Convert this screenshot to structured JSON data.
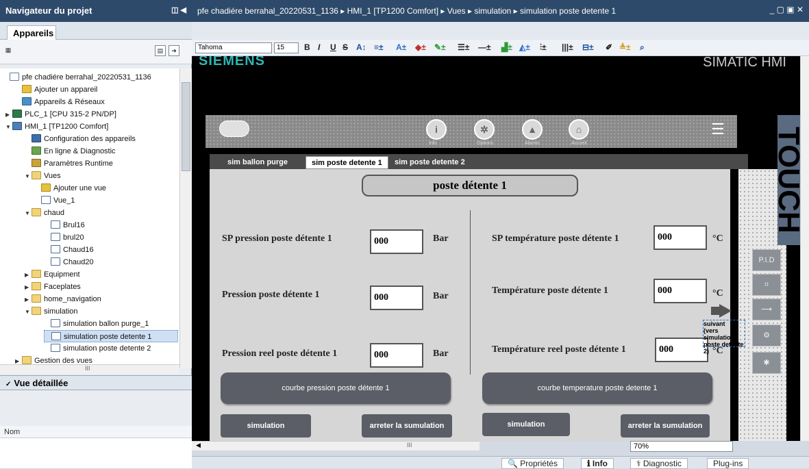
{
  "left_panel": {
    "title": "Navigateur du projet",
    "tab": "Appareils",
    "tree": [
      {
        "label": "pfe chadiére berrahal_20220531_1136",
        "icon": "project-icon"
      },
      {
        "label": "Ajouter un appareil",
        "icon": "add-device-icon"
      },
      {
        "label": "Appareils & Réseaux",
        "icon": "network-icon"
      },
      {
        "label": "PLC_1 [CPU 315-2 PN/DP]",
        "icon": "plc-icon"
      },
      {
        "label": "HMI_1 [TP1200 Comfort]",
        "icon": "hmi-icon"
      },
      {
        "label": "Configuration des appareils",
        "icon": "config-icon"
      },
      {
        "label": "En ligne & Diagnostic",
        "icon": "diagnostic-icon"
      },
      {
        "label": "Paramètres Runtime",
        "icon": "runtime-icon"
      },
      {
        "label": "Vues",
        "icon": "folder-icon"
      },
      {
        "label": "Ajouter une vue",
        "icon": "add-view-icon"
      },
      {
        "label": "Vue_1",
        "icon": "view-icon"
      },
      {
        "label": "chaud",
        "icon": "folder-icon"
      },
      {
        "label": "Brul16",
        "icon": "view-icon"
      },
      {
        "label": "brul20",
        "icon": "view-icon"
      },
      {
        "label": "Chaud16",
        "icon": "view-icon"
      },
      {
        "label": "Chaud20",
        "icon": "view-icon"
      },
      {
        "label": "Equipment",
        "icon": "folder-icon"
      },
      {
        "label": "Faceplates",
        "icon": "folder-icon"
      },
      {
        "label": "home_navigation",
        "icon": "folder-icon"
      },
      {
        "label": "simulation",
        "icon": "folder-icon"
      },
      {
        "label": "simulation ballon purge_1",
        "icon": "view-icon"
      },
      {
        "label": "simulation poste detente 1",
        "icon": "view-icon"
      },
      {
        "label": "simulation poste detente 2",
        "icon": "view-icon"
      },
      {
        "label": "Gestion des vues",
        "icon": "folder-icon"
      }
    ],
    "scroll_mid": "III",
    "detail_title": "Vue détaillée",
    "detail_col": "Nom"
  },
  "editor": {
    "breadcrumb": "pfe chadiére berrahal_20220531_1136  ▸  HMI_1 [TP1200 Comfort]  ▸  Vues  ▸  simulation  ▸  simulation poste detente 1",
    "font": "Tahoma",
    "font_size": "15",
    "zoom": "70%",
    "brand": "SIEMENS",
    "device": "SIMATIC HMI",
    "touch": "TOUCH",
    "scroll_mid": "III"
  },
  "nav_icons": [
    {
      "label": "Info",
      "glyph": "i",
      "icon": "info-icon"
    },
    {
      "label": "Options",
      "glyph": "✲",
      "icon": "options-icon"
    },
    {
      "label": "Alarms",
      "glyph": "▲",
      "icon": "alarms-icon"
    },
    {
      "label": "Accueil",
      "glyph": "⌂",
      "icon": "home-icon"
    }
  ],
  "screen_tabs": [
    "sim ballon purge",
    "sim poste detente 1",
    "sim poste detente 2"
  ],
  "screen": {
    "title": "poste détente 1",
    "sp_pression_label": "SP pression poste détente 1",
    "sp_pression_value": "000",
    "unit_bar": "Bar",
    "pression_label": "Pression poste détente 1",
    "pression_value": "000",
    "pression_reel_label": "Pression reel poste détente 1",
    "pression_reel_value": "000",
    "sp_temp_label": "SP température poste détente 1",
    "sp_temp_value": "000",
    "unit_c": "°C",
    "temp_label": "Température poste détente 1",
    "temp_value": "000",
    "temp_reel_label": "Température reel poste détente 1",
    "temp_reel_value": "000",
    "courbe_pression": "courbe pression poste détente 1",
    "courbe_temp": "courbe temperature poste detente 1",
    "simulation": "simulation",
    "arreter": "arreter la sumulation",
    "suivant": "suivant\n(vers simulation poste detente 2)"
  },
  "right_buttons": [
    "P.I.D",
    "⌗",
    "⟶",
    "⚙",
    "✱"
  ],
  "status_bar": {
    "proprietes": "Propriétés",
    "info": "Info",
    "diagnostic": "Diagnostic",
    "plugins": "Plug-ins"
  }
}
